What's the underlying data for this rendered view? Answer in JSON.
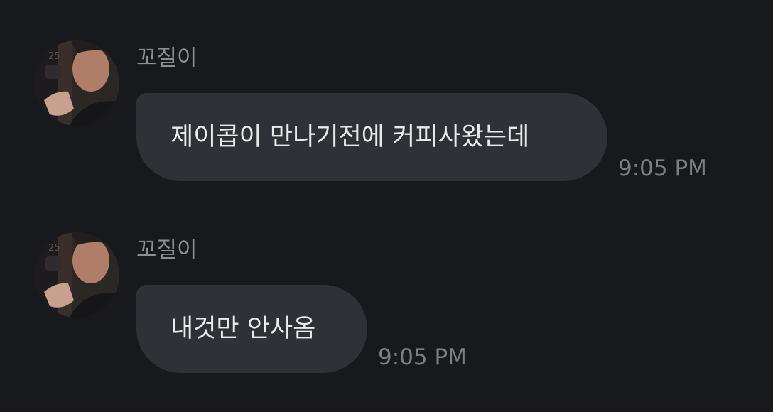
{
  "messages": [
    {
      "sender": "꼬질이",
      "text": "제이콥이 만나기전에 커피사왔는데",
      "time": "9:05 PM"
    },
    {
      "sender": "꼬질이",
      "text": "내것만 안사옴",
      "time": "9:05 PM"
    }
  ],
  "colors": {
    "background": "#18191c",
    "bubble": "#2f3136",
    "message_text": "#e9eaec",
    "sender_text": "#8d8e92",
    "timestamp_text": "#7d7e82"
  }
}
